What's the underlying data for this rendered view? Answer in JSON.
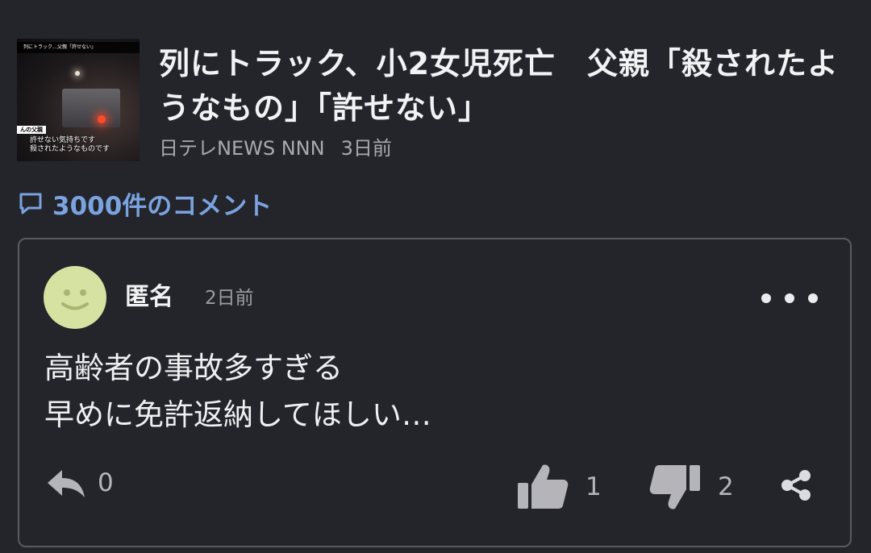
{
  "article": {
    "thumbnail": {
      "top_caption": "列にトラック…父親「許せない」",
      "tag": "んの父親",
      "caption_line1": "許せない気持ちです",
      "caption_line2": "殺されたようなものです"
    },
    "title": "列にトラック、小2女児死亡　父親「殺されたようなもの」「許せない」",
    "source": "日テレNEWS NNN",
    "time": "3日前"
  },
  "comments_header": {
    "icon": "comment-bubble-icon",
    "label": "3000件のコメント",
    "color": "#7aa3e0"
  },
  "comment": {
    "avatar_icon": "smiley-avatar-icon",
    "avatar_color": "#d5e2a2",
    "author": "匿名",
    "time": "2日前",
    "body_line1": "高齢者の事故多すぎる",
    "body_line2": "早めに免許返納してほしい…",
    "reply_count": "0",
    "like_count": "1",
    "dislike_count": "2"
  }
}
